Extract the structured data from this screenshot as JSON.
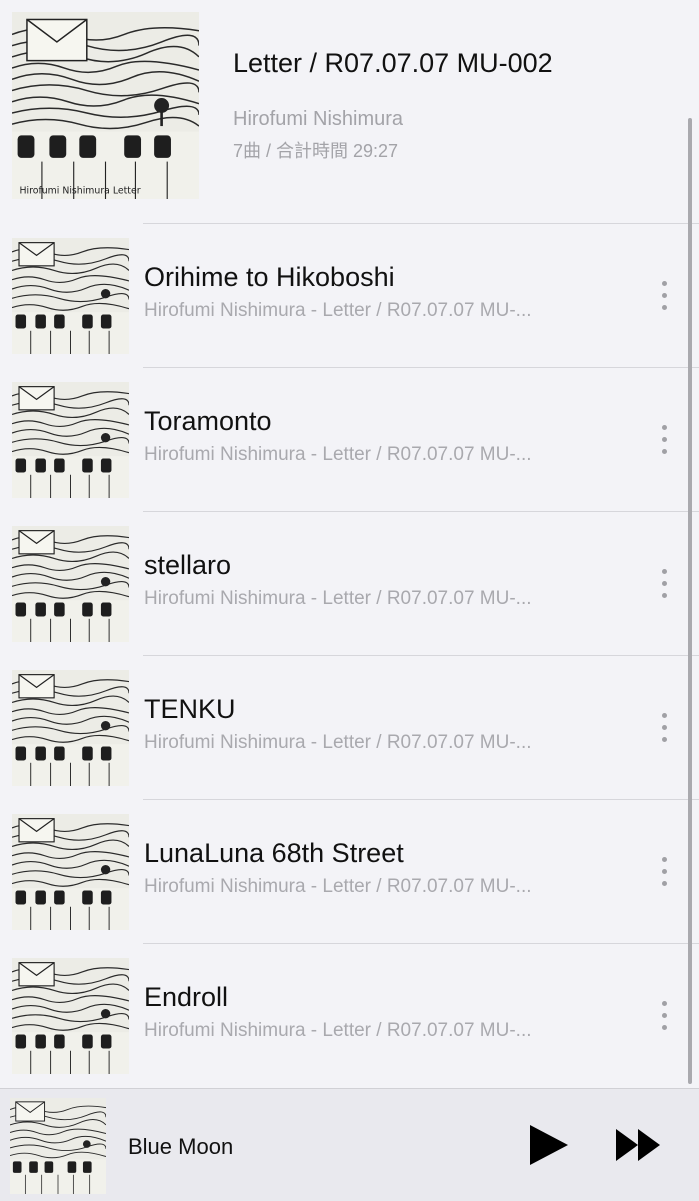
{
  "album": {
    "title": "Letter / R07.07.07 MU-002",
    "artist": "Hirofumi Nishimura",
    "meta": "7曲 / 合計時間 29:27",
    "art_text": "Hirofumi Nishimura Letter"
  },
  "tracks": [
    {
      "title": "Orihime to Hikoboshi",
      "subtitle": "Hirofumi Nishimura - Letter / R07.07.07 MU-..."
    },
    {
      "title": "Toramonto",
      "subtitle": "Hirofumi Nishimura - Letter / R07.07.07 MU-..."
    },
    {
      "title": "stellaro",
      "subtitle": "Hirofumi Nishimura - Letter / R07.07.07 MU-..."
    },
    {
      "title": "TENKU",
      "subtitle": "Hirofumi Nishimura - Letter / R07.07.07 MU-..."
    },
    {
      "title": "LunaLuna 68th Street",
      "subtitle": "Hirofumi Nishimura - Letter / R07.07.07 MU-..."
    },
    {
      "title": "Endroll",
      "subtitle": "Hirofumi Nishimura - Letter / R07.07.07 MU-..."
    }
  ],
  "now_playing": {
    "title": "Blue Moon"
  },
  "colors": {
    "background": "#f3f3f7",
    "primary_text": "#111111",
    "secondary_text": "#a3a3a8",
    "divider": "#d6d6db",
    "player_bg": "#e9e9ee"
  },
  "icons": {
    "more": "more-vertical-icon",
    "play": "play-icon",
    "fast_forward": "fast-forward-icon"
  }
}
